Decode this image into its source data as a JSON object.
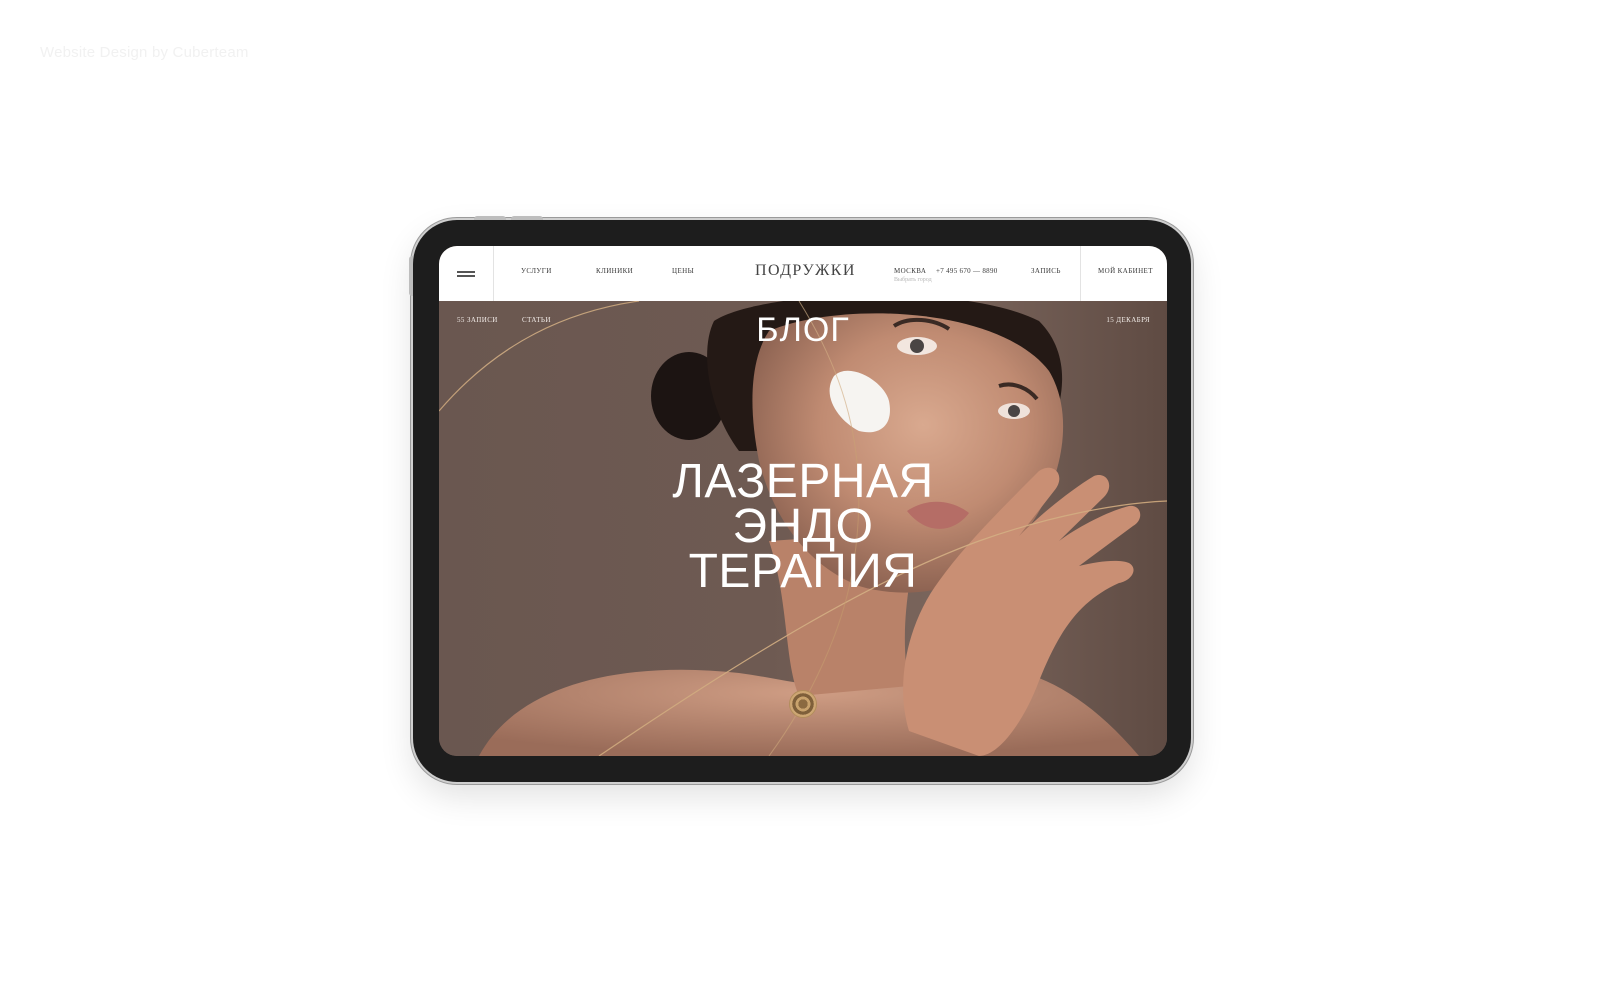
{
  "watermark": "Website Design by Cuberteam",
  "header": {
    "nav": [
      "Услуги",
      "Клиники",
      "Цены"
    ],
    "logo": "ПОДРУЖКИ",
    "city": "Москва",
    "city_hint": "Выбрать город",
    "phone": "+7 495 670 — 8890",
    "signup": "Запись",
    "cabinet": "Мой кабинет"
  },
  "hero": {
    "records_count": "55 записи",
    "category": "Статьи",
    "date": "15 декабря",
    "section_title": "БЛОГ",
    "headline": [
      "ЛАЗЕРНАЯ",
      "ЭНДО",
      "ТЕРАПИЯ"
    ]
  },
  "colors": {
    "hero_background": "#6f5a52",
    "accent_gold": "#c9a36d",
    "header_background": "#ffffff",
    "device_frame": "#1d1d1d"
  },
  "icons": {
    "menu": "hamburger-menu-icon",
    "emblem": "round-gold-emblem"
  }
}
